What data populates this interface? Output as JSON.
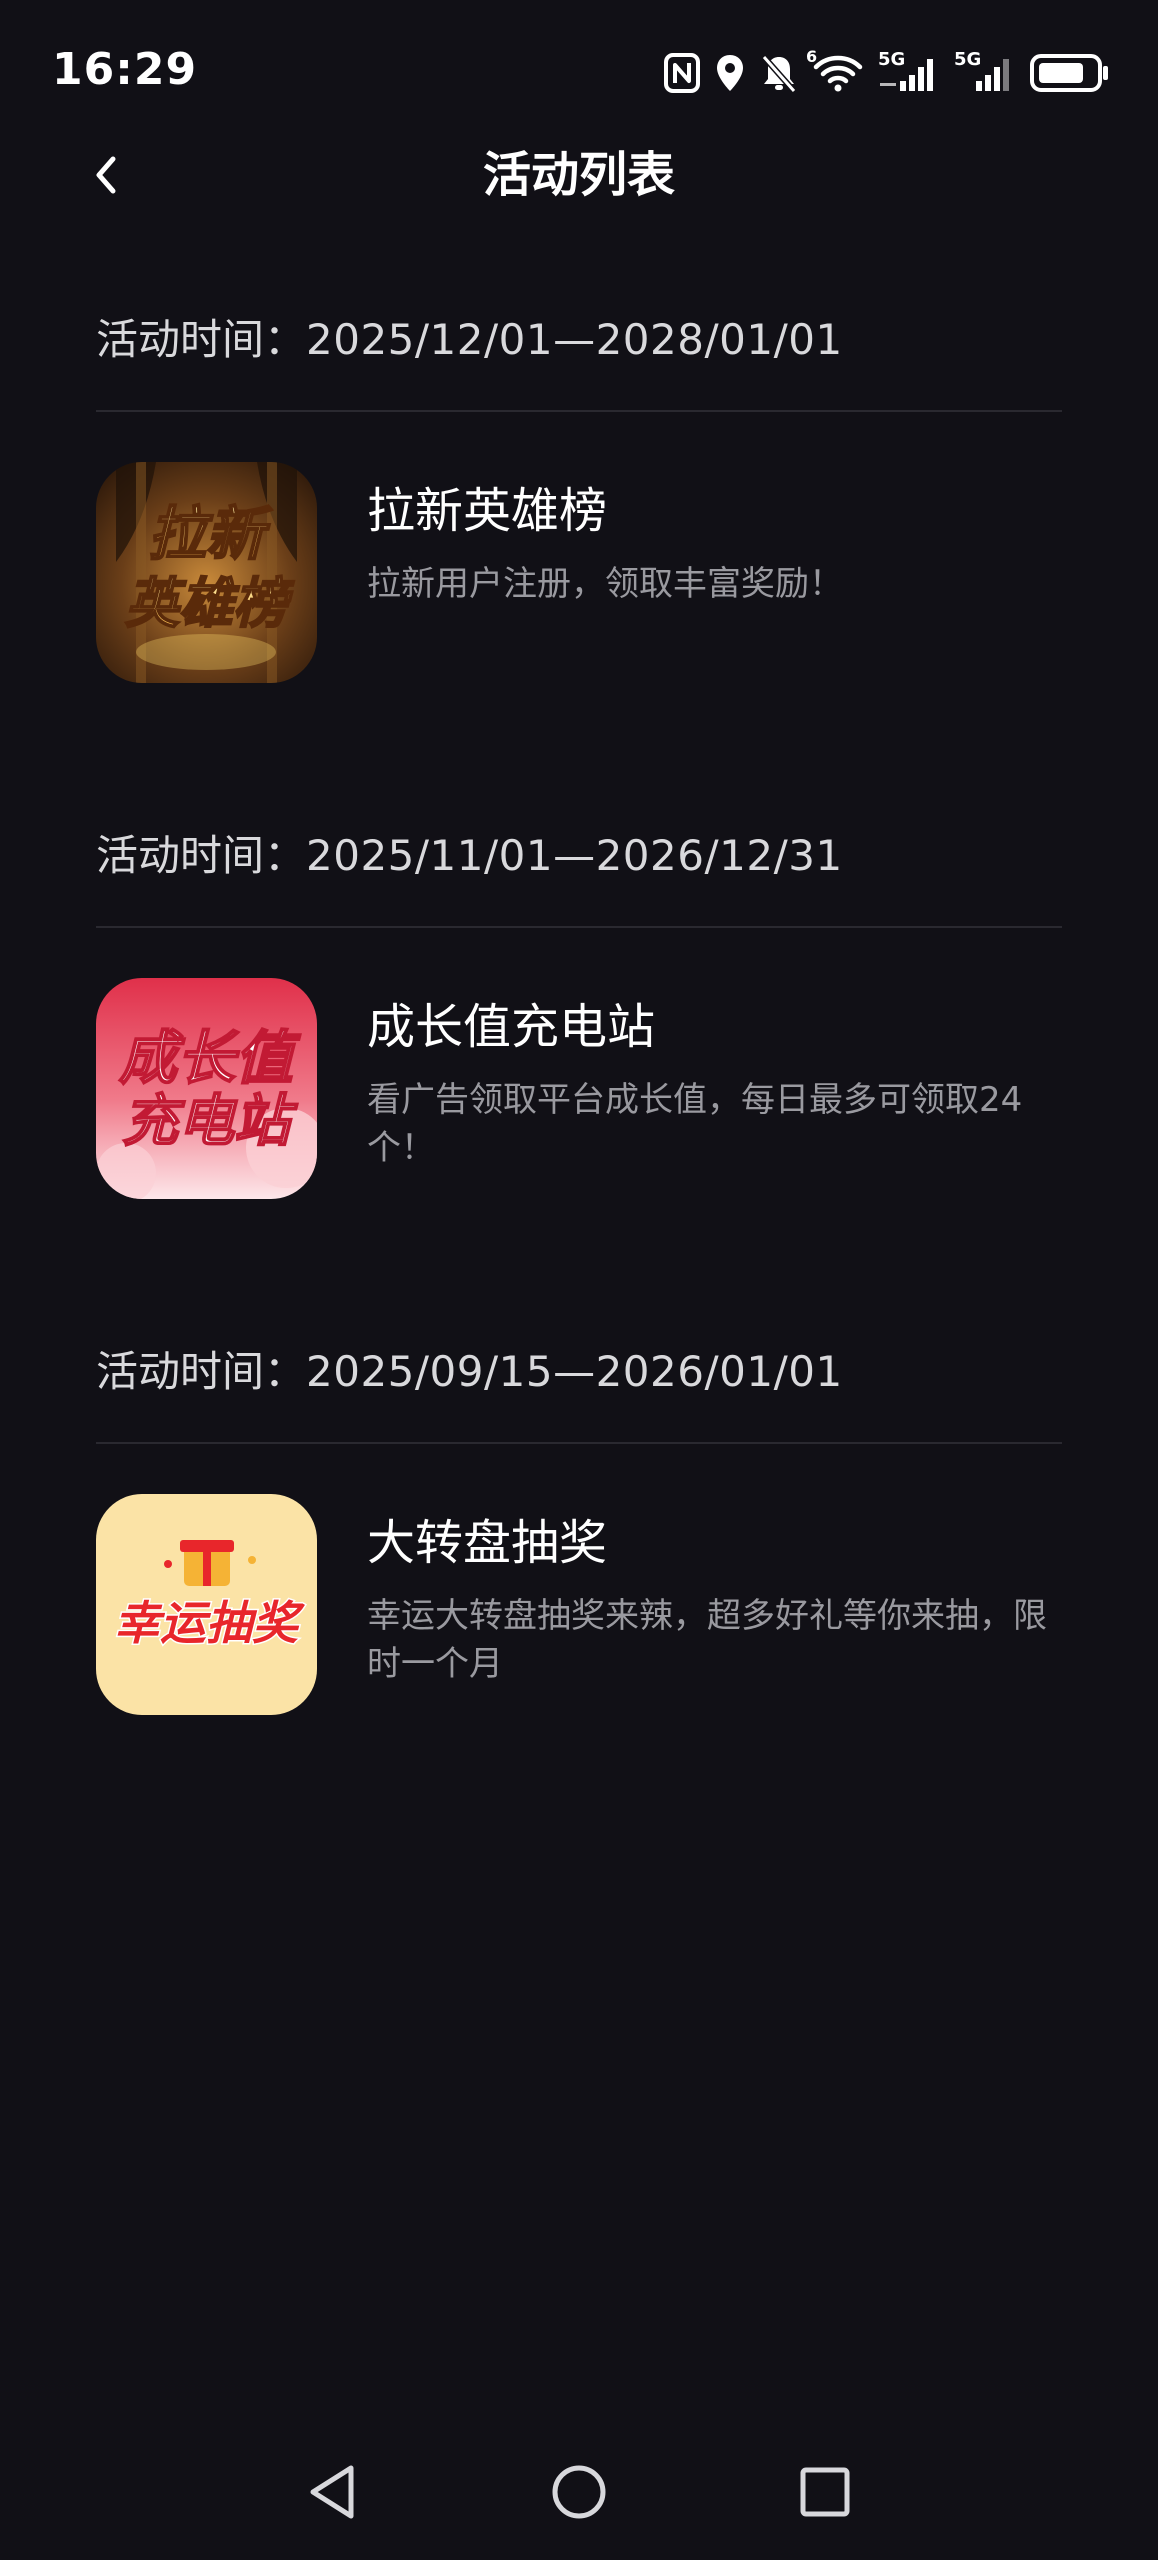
{
  "status_bar": {
    "time": "16:29",
    "icons": [
      "nfc-icon",
      "location-icon",
      "bell-off-icon",
      "wifi-icon",
      "signal-5g-icon",
      "signal-5g-icon",
      "battery-icon"
    ],
    "network_labels": [
      "5G",
      "5G"
    ],
    "wifi_badge": "6"
  },
  "header": {
    "title": "活动列表",
    "back_icon": "chevron-left-icon"
  },
  "activities": [
    {
      "time_label": "活动时间：",
      "time_range": "2025/12/01—2028/01/01",
      "name": "拉新英雄榜",
      "description": "拉新用户注册，领取丰富奖励！",
      "thumb_text_line1": "拉新",
      "thumb_text_line2": "英雄榜",
      "thumb_colors": [
        "#3a2410",
        "#c98a3a",
        "#f7d36b"
      ]
    },
    {
      "time_label": "活动时间：",
      "time_range": "2025/11/01—2026/12/31",
      "name": "成长值充电站",
      "description": "看广告领取平台成长值，每日最多可领取24个！",
      "thumb_text_line1": "成长值",
      "thumb_text_line2": "充电站",
      "thumb_colors": [
        "#e0304a",
        "#f4a0a8",
        "#fde7ea"
      ]
    },
    {
      "time_label": "活动时间：",
      "time_range": "2025/09/15—2026/01/01",
      "name": "大转盘抽奖",
      "description": "幸运大转盘抽奖来辣，超多好礼等你来抽，限时一个月",
      "thumb_text_line1": "幸运抽奖",
      "thumb_colors": [
        "#fbe3a6",
        "#e8262b",
        "#f5b335"
      ]
    }
  ],
  "nav_bar": {
    "back": "triangle-back-icon",
    "home": "circle-home-icon",
    "recents": "square-recents-icon"
  },
  "colors": {
    "background": "#111016",
    "primary_text": "#ffffff",
    "secondary_text": "#9a9aa0",
    "divider": "#2a2930"
  }
}
